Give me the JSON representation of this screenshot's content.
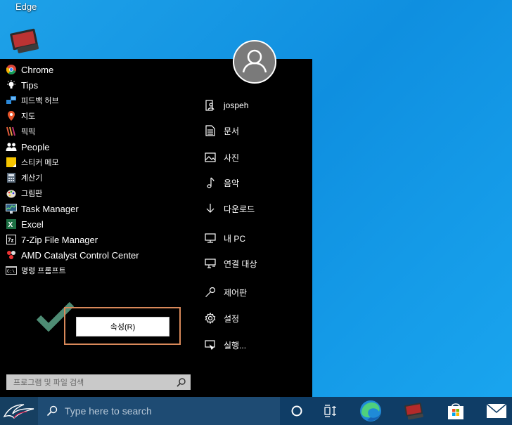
{
  "desktop": {
    "edge_label": "Edge"
  },
  "start_menu": {
    "apps": [
      {
        "label": "Chrome",
        "icon": "chrome-icon",
        "lang": "en"
      },
      {
        "label": "Tips",
        "icon": "lightbulb-icon",
        "lang": "en"
      },
      {
        "label": "피드백 허브",
        "icon": "feedback-hub-icon",
        "lang": "ko"
      },
      {
        "label": "지도",
        "icon": "map-pin-icon",
        "lang": "ko"
      },
      {
        "label": "픽픽",
        "icon": "picpick-icon",
        "lang": "ko"
      },
      {
        "label": "People",
        "icon": "people-icon",
        "lang": "en"
      },
      {
        "label": "스티커 메모",
        "icon": "sticky-notes-icon",
        "lang": "ko"
      },
      {
        "label": "계산기",
        "icon": "calculator-icon",
        "lang": "ko"
      },
      {
        "label": "그림판",
        "icon": "paint-icon",
        "lang": "ko"
      },
      {
        "label": "Task Manager",
        "icon": "task-manager-icon",
        "lang": "en"
      },
      {
        "label": "Excel",
        "icon": "excel-icon",
        "lang": "en"
      },
      {
        "label": "7-Zip File Manager",
        "icon": "7zip-icon",
        "lang": "en"
      },
      {
        "label": "AMD Catalyst Control Center",
        "icon": "amd-catalyst-icon",
        "lang": "en"
      },
      {
        "label": "명령 프롬프트",
        "icon": "command-prompt-icon",
        "lang": "ko"
      }
    ],
    "places": [
      {
        "label": "jospeh",
        "icon": "user-folder-icon"
      },
      {
        "label": "문서",
        "icon": "document-icon"
      },
      {
        "label": "사진",
        "icon": "pictures-icon"
      },
      {
        "label": "음악",
        "icon": "music-icon"
      },
      {
        "label": "다운로드",
        "icon": "download-icon"
      },
      {
        "label": "내 PC",
        "icon": "computer-icon"
      },
      {
        "label": "연결 대상",
        "icon": "connect-icon"
      },
      {
        "label": "제어판",
        "icon": "control-panel-icon"
      },
      {
        "label": "설정",
        "icon": "settings-gear-icon"
      },
      {
        "label": "실행...",
        "icon": "run-icon"
      }
    ],
    "properties_button": "속성(R)",
    "search_placeholder": "프로그램 및 파일 검색"
  },
  "taskbar": {
    "search_placeholder": "Type here to search"
  },
  "colors": {
    "desktop_blue": "#1ea1e8",
    "taskbar": "#0f3d66",
    "highlight_border": "#d9895a",
    "check_green": "#4e8c74"
  }
}
